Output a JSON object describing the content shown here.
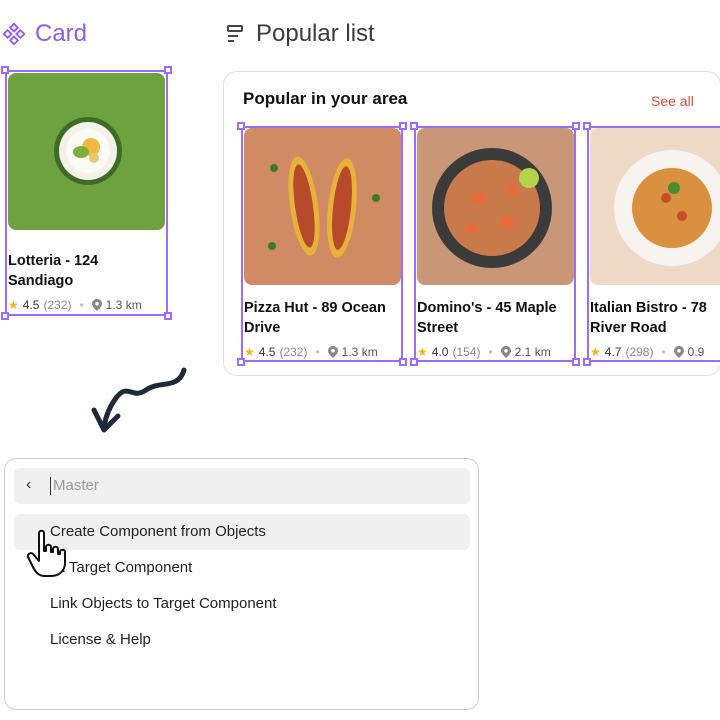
{
  "headings": {
    "card": "Card",
    "popular": "Popular list"
  },
  "card": {
    "title": "Lotteria - 124 Sandiago",
    "rating": "4.5",
    "reviews": "(232)",
    "distance": "1.3 km"
  },
  "popular": {
    "title": "Popular in your area",
    "see_all": "See all",
    "items": [
      {
        "title": "Pizza Hut - 89 Ocean Drive",
        "rating": "4.5",
        "reviews": "(232)",
        "distance": "1.3 km"
      },
      {
        "title": "Domino's - 45 Maple Street",
        "rating": "4.0",
        "reviews": "(154)",
        "distance": "2.1 km"
      },
      {
        "title": "Italian Bistro - 78 River Road",
        "rating": "4.7",
        "reviews": "(298)",
        "distance": "0.9"
      }
    ]
  },
  "palette": {
    "search_placeholder": "Master",
    "menu": [
      "Create Component from Objects",
      "ck Target Component",
      "Link Objects to Target Component",
      "License & Help"
    ]
  },
  "colors": {
    "accent": "#8b5cf6",
    "selection": "#9d6bff",
    "see_all": "#e0483b"
  }
}
